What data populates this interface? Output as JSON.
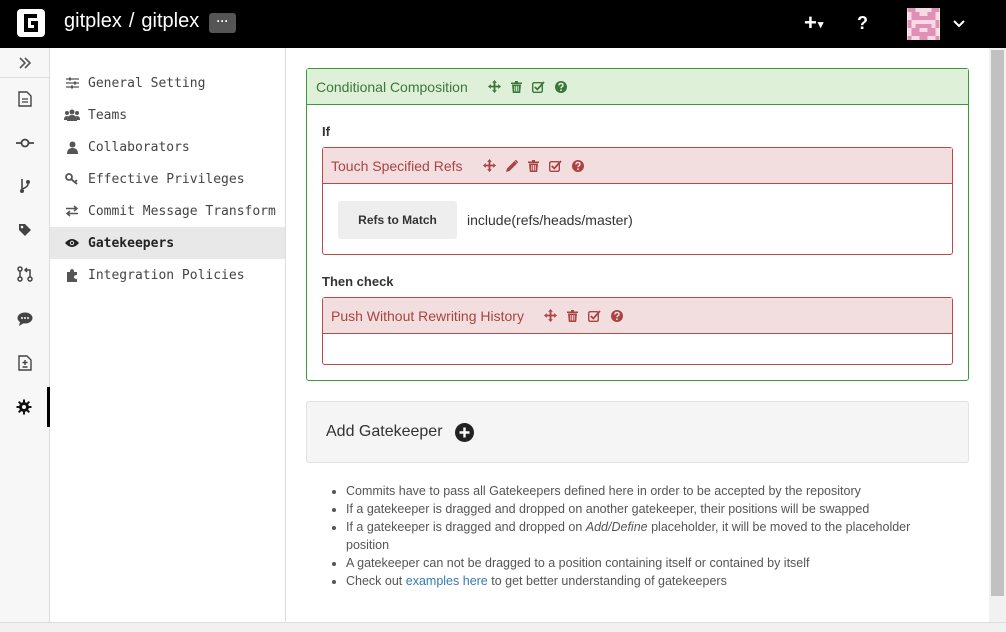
{
  "header": {
    "owner": "gitplex",
    "separator": "/",
    "repo": "gitplex",
    "more_label": "···",
    "plus_label": "+",
    "caret": "▾",
    "help_label": "?"
  },
  "rail": {
    "icons": [
      "expand-icon",
      "file-icon",
      "commit-icon",
      "branch-icon",
      "tag-icon",
      "pull-request-icon",
      "comment-icon",
      "compare-icon",
      "gear-icon"
    ],
    "active": "gear-icon"
  },
  "settings_nav": {
    "items": [
      {
        "label": "General Setting",
        "icon": "sliders-icon"
      },
      {
        "label": "Teams",
        "icon": "users-icon"
      },
      {
        "label": "Collaborators",
        "icon": "user-icon"
      },
      {
        "label": "Effective Privileges",
        "icon": "key-icon"
      },
      {
        "label": "Commit Message Transform",
        "icon": "exchange-icon"
      },
      {
        "label": "Gatekeepers",
        "icon": "eye-icon"
      },
      {
        "label": "Integration Policies",
        "icon": "puzzle-icon"
      }
    ],
    "active": "Gatekeepers"
  },
  "gatekeeper": {
    "title": "Conditional Composition",
    "if_label": "If",
    "then_label": "Then check",
    "condition": {
      "title": "Touch Specified Refs",
      "param_label": "Refs to Match",
      "param_value": "include(refs/heads/master)"
    },
    "check": {
      "title": "Push Without Rewriting History"
    }
  },
  "add": {
    "label": "Add Gatekeeper"
  },
  "tips": {
    "t1": "Commits have to pass all Gatekeepers defined here in order to be accepted by the repository",
    "t2": "If a gatekeeper is dragged and dropped on another gatekeeper, their positions will be swapped",
    "t3_pre": "If a gatekeeper is dragged and dropped on ",
    "t3_em": "Add/Define",
    "t3_post": " placeholder, it will be moved to the placeholder position",
    "t4": "A gatekeeper can not be dragged to a position containing itself or contained by itself",
    "t5_pre": "Check out ",
    "t5_link": "examples here",
    "t5_post": " to get better understanding of gatekeepers"
  },
  "colors": {
    "success_border": "#3c9a3c",
    "success_bg": "#dff0d8",
    "danger_border": "#b94a48",
    "danger_bg": "#f2dede",
    "link": "#337ab7"
  }
}
